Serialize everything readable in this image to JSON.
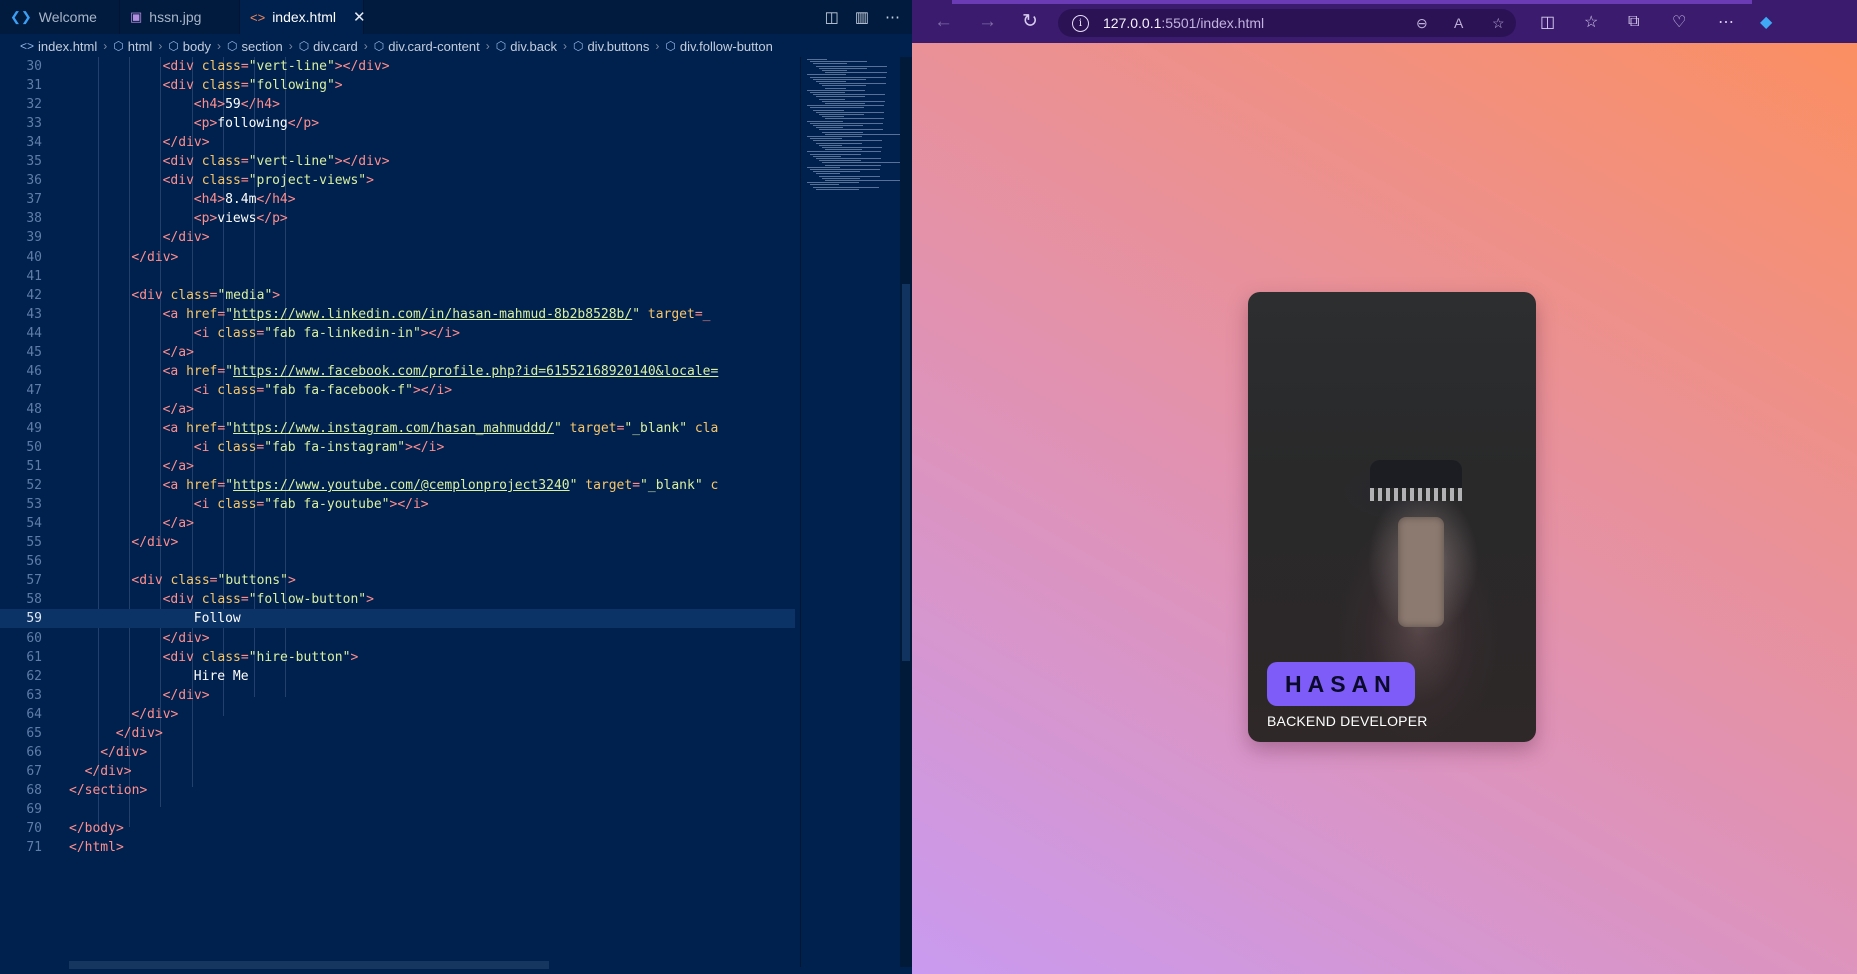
{
  "editor": {
    "tabs": [
      {
        "label": "Welcome",
        "icon": "vscode-icon"
      },
      {
        "label": "hssn.jpg",
        "icon": "image-icon"
      },
      {
        "label": "index.html",
        "icon": "html-icon",
        "active": true
      }
    ],
    "breadcrumb": [
      "index.html",
      "html",
      "body",
      "section",
      "div.card",
      "div.card-content",
      "div.back",
      "div.buttons",
      "div.follow-button"
    ],
    "current_line": 59,
    "lines": [
      {
        "n": "30",
        "indent": 12,
        "parts": [
          [
            "t",
            "<"
          ],
          [
            "t",
            "div"
          ],
          [
            "a",
            " class"
          ],
          [
            "t",
            "="
          ],
          [
            "s",
            "\"vert-line\""
          ],
          [
            "t",
            ">"
          ],
          [
            "t",
            "</"
          ],
          [
            "t",
            "div"
          ],
          [
            "t",
            ">"
          ]
        ]
      },
      {
        "n": "31",
        "indent": 12,
        "parts": [
          [
            "t",
            "<"
          ],
          [
            "t",
            "div"
          ],
          [
            "a",
            " class"
          ],
          [
            "t",
            "="
          ],
          [
            "s",
            "\"following\""
          ],
          [
            "t",
            ">"
          ]
        ]
      },
      {
        "n": "32",
        "indent": 16,
        "parts": [
          [
            "t",
            "<"
          ],
          [
            "t",
            "h4"
          ],
          [
            "t",
            ">"
          ],
          [
            "x",
            "59"
          ],
          [
            "t",
            "</"
          ],
          [
            "t",
            "h4"
          ],
          [
            "t",
            ">"
          ]
        ]
      },
      {
        "n": "33",
        "indent": 16,
        "parts": [
          [
            "t",
            "<"
          ],
          [
            "t",
            "p"
          ],
          [
            "t",
            ">"
          ],
          [
            "x",
            "following"
          ],
          [
            "t",
            "</"
          ],
          [
            "t",
            "p"
          ],
          [
            "t",
            ">"
          ]
        ]
      },
      {
        "n": "34",
        "indent": 12,
        "parts": [
          [
            "t",
            "</"
          ],
          [
            "t",
            "div"
          ],
          [
            "t",
            ">"
          ]
        ]
      },
      {
        "n": "35",
        "indent": 12,
        "parts": [
          [
            "t",
            "<"
          ],
          [
            "t",
            "div"
          ],
          [
            "a",
            " class"
          ],
          [
            "t",
            "="
          ],
          [
            "s",
            "\"vert-line\""
          ],
          [
            "t",
            ">"
          ],
          [
            "t",
            "</"
          ],
          [
            "t",
            "div"
          ],
          [
            "t",
            ">"
          ]
        ]
      },
      {
        "n": "36",
        "indent": 12,
        "parts": [
          [
            "t",
            "<"
          ],
          [
            "t",
            "div"
          ],
          [
            "a",
            " class"
          ],
          [
            "t",
            "="
          ],
          [
            "s",
            "\"project-views\""
          ],
          [
            "t",
            ">"
          ]
        ]
      },
      {
        "n": "37",
        "indent": 16,
        "parts": [
          [
            "t",
            "<"
          ],
          [
            "t",
            "h4"
          ],
          [
            "t",
            ">"
          ],
          [
            "x",
            "8.4m"
          ],
          [
            "t",
            "</"
          ],
          [
            "t",
            "h4"
          ],
          [
            "t",
            ">"
          ]
        ]
      },
      {
        "n": "38",
        "indent": 16,
        "parts": [
          [
            "t",
            "<"
          ],
          [
            "t",
            "p"
          ],
          [
            "t",
            ">"
          ],
          [
            "x",
            "views"
          ],
          [
            "t",
            "</"
          ],
          [
            "t",
            "p"
          ],
          [
            "t",
            ">"
          ]
        ]
      },
      {
        "n": "39",
        "indent": 12,
        "parts": [
          [
            "t",
            "</"
          ],
          [
            "t",
            "div"
          ],
          [
            "t",
            ">"
          ]
        ]
      },
      {
        "n": "40",
        "indent": 8,
        "parts": [
          [
            "t",
            "</"
          ],
          [
            "t",
            "div"
          ],
          [
            "t",
            ">"
          ]
        ]
      },
      {
        "n": "41",
        "indent": 0,
        "parts": []
      },
      {
        "n": "42",
        "indent": 8,
        "parts": [
          [
            "t",
            "<"
          ],
          [
            "t",
            "div"
          ],
          [
            "a",
            " class"
          ],
          [
            "t",
            "="
          ],
          [
            "s",
            "\"media\""
          ],
          [
            "t",
            ">"
          ]
        ]
      },
      {
        "n": "43",
        "indent": 12,
        "parts": [
          [
            "t",
            "<"
          ],
          [
            "t",
            "a"
          ],
          [
            "a",
            " href"
          ],
          [
            "t",
            "="
          ],
          [
            "s",
            "\""
          ],
          [
            "u",
            "https://www.linkedin.com/in/hasan-mahmud-8b2b8528b/"
          ],
          [
            "s",
            "\""
          ],
          [
            "a",
            " target"
          ],
          [
            "t",
            "=_"
          ]
        ]
      },
      {
        "n": "44",
        "indent": 16,
        "parts": [
          [
            "t",
            "<"
          ],
          [
            "t",
            "i"
          ],
          [
            "a",
            " class"
          ],
          [
            "t",
            "="
          ],
          [
            "s",
            "\"fab fa-linkedin-in\""
          ],
          [
            "t",
            ">"
          ],
          [
            "t",
            "</"
          ],
          [
            "t",
            "i"
          ],
          [
            "t",
            ">"
          ]
        ]
      },
      {
        "n": "45",
        "indent": 12,
        "parts": [
          [
            "t",
            "</"
          ],
          [
            "t",
            "a"
          ],
          [
            "t",
            ">"
          ]
        ]
      },
      {
        "n": "46",
        "indent": 12,
        "parts": [
          [
            "t",
            "<"
          ],
          [
            "t",
            "a"
          ],
          [
            "a",
            " href"
          ],
          [
            "t",
            "="
          ],
          [
            "s",
            "\""
          ],
          [
            "u",
            "https://www.facebook.com/profile.php?id=61552168920140&locale="
          ]
        ]
      },
      {
        "n": "47",
        "indent": 16,
        "parts": [
          [
            "t",
            "<"
          ],
          [
            "t",
            "i"
          ],
          [
            "a",
            " class"
          ],
          [
            "t",
            "="
          ],
          [
            "s",
            "\"fab fa-facebook-f\""
          ],
          [
            "t",
            ">"
          ],
          [
            "t",
            "</"
          ],
          [
            "t",
            "i"
          ],
          [
            "t",
            ">"
          ]
        ]
      },
      {
        "n": "48",
        "indent": 12,
        "parts": [
          [
            "t",
            "</"
          ],
          [
            "t",
            "a"
          ],
          [
            "t",
            ">"
          ]
        ]
      },
      {
        "n": "49",
        "indent": 12,
        "parts": [
          [
            "t",
            "<"
          ],
          [
            "t",
            "a"
          ],
          [
            "a",
            " href"
          ],
          [
            "t",
            "="
          ],
          [
            "s",
            "\""
          ],
          [
            "u",
            "https://www.instagram.com/hasan_mahmuddd/"
          ],
          [
            "s",
            "\""
          ],
          [
            "a",
            " target"
          ],
          [
            "t",
            "="
          ],
          [
            "s",
            "\"_blank\""
          ],
          [
            "a",
            " cla"
          ]
        ]
      },
      {
        "n": "50",
        "indent": 16,
        "parts": [
          [
            "t",
            "<"
          ],
          [
            "t",
            "i"
          ],
          [
            "a",
            " class"
          ],
          [
            "t",
            "="
          ],
          [
            "s",
            "\"fab fa-instagram\""
          ],
          [
            "t",
            ">"
          ],
          [
            "t",
            "</"
          ],
          [
            "t",
            "i"
          ],
          [
            "t",
            ">"
          ]
        ]
      },
      {
        "n": "51",
        "indent": 12,
        "parts": [
          [
            "t",
            "</"
          ],
          [
            "t",
            "a"
          ],
          [
            "t",
            ">"
          ]
        ]
      },
      {
        "n": "52",
        "indent": 12,
        "parts": [
          [
            "t",
            "<"
          ],
          [
            "t",
            "a"
          ],
          [
            "a",
            " href"
          ],
          [
            "t",
            "="
          ],
          [
            "s",
            "\""
          ],
          [
            "u",
            "https://www.youtube.com/@cemplonproject3240"
          ],
          [
            "s",
            "\""
          ],
          [
            "a",
            " target"
          ],
          [
            "t",
            "="
          ],
          [
            "s",
            "\"_blank\""
          ],
          [
            "a",
            " c"
          ]
        ]
      },
      {
        "n": "53",
        "indent": 16,
        "parts": [
          [
            "t",
            "<"
          ],
          [
            "t",
            "i"
          ],
          [
            "a",
            " class"
          ],
          [
            "t",
            "="
          ],
          [
            "s",
            "\"fab fa-youtube\""
          ],
          [
            "t",
            ">"
          ],
          [
            "t",
            "</"
          ],
          [
            "t",
            "i"
          ],
          [
            "t",
            ">"
          ]
        ]
      },
      {
        "n": "54",
        "indent": 12,
        "parts": [
          [
            "t",
            "</"
          ],
          [
            "t",
            "a"
          ],
          [
            "t",
            ">"
          ]
        ]
      },
      {
        "n": "55",
        "indent": 8,
        "parts": [
          [
            "t",
            "</"
          ],
          [
            "t",
            "div"
          ],
          [
            "t",
            ">"
          ]
        ]
      },
      {
        "n": "56",
        "indent": 0,
        "parts": []
      },
      {
        "n": "57",
        "indent": 8,
        "parts": [
          [
            "t",
            "<"
          ],
          [
            "t",
            "div"
          ],
          [
            "a",
            " class"
          ],
          [
            "t",
            "="
          ],
          [
            "s",
            "\"buttons\""
          ],
          [
            "t",
            ">"
          ]
        ]
      },
      {
        "n": "58",
        "indent": 12,
        "parts": [
          [
            "t",
            "<"
          ],
          [
            "t",
            "div"
          ],
          [
            "a",
            " class"
          ],
          [
            "t",
            "="
          ],
          [
            "s",
            "\"follow-button\""
          ],
          [
            "t",
            ">"
          ]
        ]
      },
      {
        "n": "59",
        "indent": 16,
        "parts": [
          [
            "x",
            "Follow"
          ]
        ]
      },
      {
        "n": "60",
        "indent": 12,
        "parts": [
          [
            "t",
            "</"
          ],
          [
            "t",
            "div"
          ],
          [
            "t",
            ">"
          ]
        ]
      },
      {
        "n": "61",
        "indent": 12,
        "parts": [
          [
            "t",
            "<"
          ],
          [
            "t",
            "div"
          ],
          [
            "a",
            " class"
          ],
          [
            "t",
            "="
          ],
          [
            "s",
            "\"hire-button\""
          ],
          [
            "t",
            ">"
          ]
        ]
      },
      {
        "n": "62",
        "indent": 16,
        "parts": [
          [
            "x",
            "Hire Me"
          ]
        ]
      },
      {
        "n": "63",
        "indent": 12,
        "parts": [
          [
            "t",
            "</"
          ],
          [
            "t",
            "div"
          ],
          [
            "t",
            ">"
          ]
        ]
      },
      {
        "n": "64",
        "indent": 8,
        "parts": [
          [
            "t",
            "</"
          ],
          [
            "t",
            "div"
          ],
          [
            "t",
            ">"
          ]
        ]
      },
      {
        "n": "65",
        "indent": 6,
        "parts": [
          [
            "t",
            "</"
          ],
          [
            "t",
            "div"
          ],
          [
            "t",
            ">"
          ]
        ]
      },
      {
        "n": "66",
        "indent": 4,
        "parts": [
          [
            "t",
            "</"
          ],
          [
            "t",
            "div"
          ],
          [
            "t",
            ">"
          ]
        ]
      },
      {
        "n": "67",
        "indent": 2,
        "parts": [
          [
            "t",
            "</"
          ],
          [
            "t",
            "div"
          ],
          [
            "t",
            ">"
          ]
        ]
      },
      {
        "n": "68",
        "indent": 0,
        "parts": [
          [
            "t",
            "</"
          ],
          [
            "t",
            "section"
          ],
          [
            "t",
            ">"
          ]
        ]
      },
      {
        "n": "69",
        "indent": 0,
        "parts": []
      },
      {
        "n": "70",
        "indent": 0,
        "parts": [
          [
            "t",
            "</"
          ],
          [
            "t",
            "body"
          ],
          [
            "t",
            ">"
          ]
        ]
      },
      {
        "n": "71",
        "indent": 0,
        "parts": [
          [
            "t",
            "</"
          ],
          [
            "t",
            "html"
          ],
          [
            "t",
            ">"
          ]
        ]
      }
    ]
  },
  "browser": {
    "address": {
      "host": "127.0.0.1",
      "path": ":5501/index.html"
    },
    "card": {
      "name": "HASAN",
      "role": "BACKEND DEVELOPER"
    }
  },
  "colors": {
    "editor_bg": "#00214d",
    "name_badge": "#7e5cf8",
    "browser_toolbar": "#3a1b6e"
  }
}
